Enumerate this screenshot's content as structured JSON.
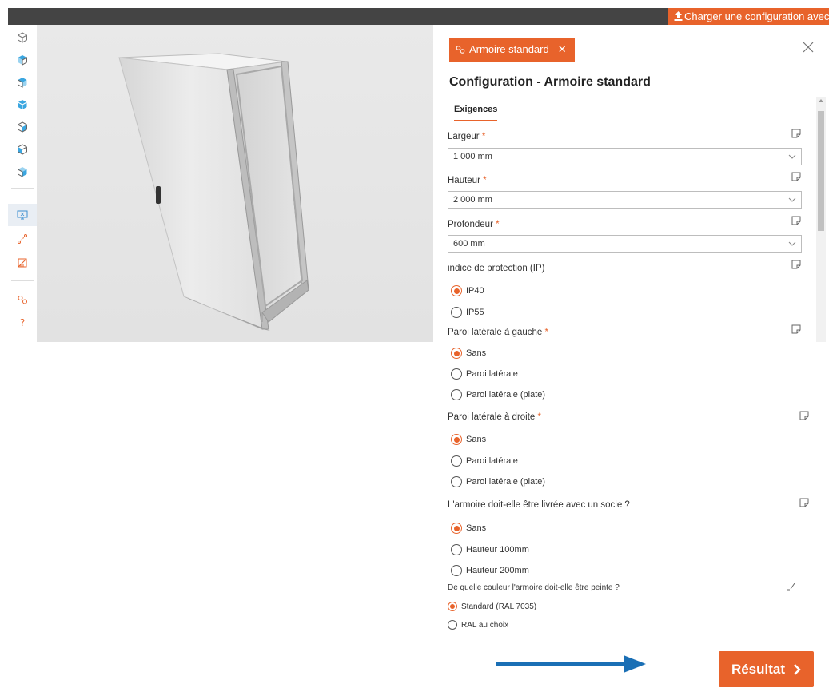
{
  "header": {
    "load_config_label": "Charger une configuration avec ID"
  },
  "sidebar": {
    "items": [
      {
        "icon": "cube-icon"
      },
      {
        "icon": "cube-colored-icon"
      },
      {
        "icon": "cube-colored-icon"
      },
      {
        "icon": "cube-colored-icon"
      },
      {
        "icon": "cube-colored-icon"
      },
      {
        "icon": "cube-colored-icon"
      },
      {
        "icon": "cube-colored-icon"
      },
      {
        "icon": "screen-icon"
      },
      {
        "icon": "connector-icon"
      },
      {
        "icon": "dimensions-icon"
      },
      {
        "icon": "link-icon"
      },
      {
        "icon": "help-icon"
      }
    ]
  },
  "panel": {
    "tag_label": "Armoire standard",
    "title": "Configuration - Armoire standard",
    "tab_label": "Exigences",
    "fields": {
      "width": {
        "label": "Largeur",
        "required": "*",
        "value": "1 000 mm"
      },
      "height": {
        "label": "Hauteur",
        "required": "*",
        "value": "2 000 mm"
      },
      "depth": {
        "label": "Profondeur",
        "required": "*",
        "value": "600 mm"
      },
      "ip": {
        "label": "indice de protection (IP)",
        "options": [
          "IP40",
          "IP55"
        ],
        "selected": "IP40"
      },
      "left_wall": {
        "label": "Paroi latérale à gauche",
        "required": "*",
        "options": [
          "Sans",
          "Paroi latérale",
          "Paroi latérale (plate)"
        ],
        "selected": "Sans"
      },
      "right_wall": {
        "label": "Paroi latérale à droite",
        "required": "*",
        "options": [
          "Sans",
          "Paroi latérale",
          "Paroi latérale (plate)"
        ],
        "selected": "Sans"
      },
      "plinth": {
        "label": "L'armoire doit-elle être livrée avec un socle ?",
        "options": [
          "Sans",
          "Hauteur 100mm",
          "Hauteur 200mm"
        ],
        "selected": "Sans"
      },
      "color": {
        "label": "De quelle couleur l'armoire doit-elle être peinte ?",
        "options": [
          "Standard (RAL 7035)",
          "RAL au choix"
        ],
        "selected": "Standard (RAL 7035)"
      }
    }
  },
  "result_label": "Résultat",
  "colors": {
    "accent": "#e8632b",
    "topbar": "#444444",
    "arrow": "#1a6fb5"
  }
}
